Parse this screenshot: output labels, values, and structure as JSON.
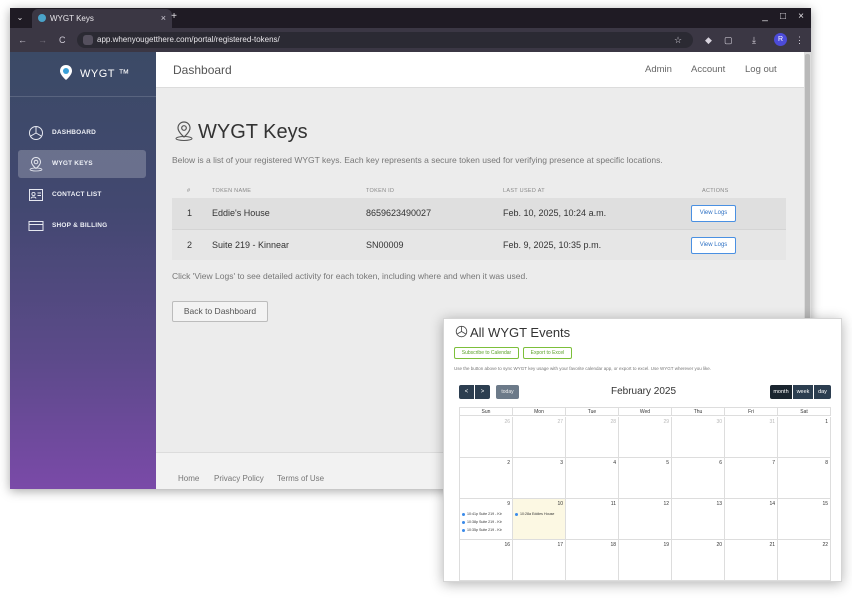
{
  "browser": {
    "tab_title": "WYGT Keys",
    "tab_close": "×",
    "new_tab": "+",
    "url": "app.whenyougetthere.com/portal/registered-tokens/",
    "nav": {
      "back": "←",
      "forward": "→",
      "reload": "C"
    },
    "window_buttons": {
      "minimize": "_",
      "maximize": "□",
      "close": "×"
    },
    "profile_initial": "R"
  },
  "sidebar": {
    "brand": "WYGT ™",
    "items": [
      {
        "label": "DASHBOARD",
        "icon": "pie-chart-icon"
      },
      {
        "label": "WYGT KEYS",
        "icon": "location-pin-icon"
      },
      {
        "label": "CONTACT LIST",
        "icon": "contact-card-icon"
      },
      {
        "label": "SHOP & BILLING",
        "icon": "credit-card-icon"
      }
    ]
  },
  "topnav": {
    "title": "Dashboard",
    "links": [
      "Admin",
      "Account",
      "Log out"
    ]
  },
  "main": {
    "title": "WYGT Keys",
    "description": "Below is a list of your registered WYGT keys. Each key represents a secure token used for verifying presence at specific locations.",
    "table": {
      "headers": [
        "#",
        "TOKEN NAME",
        "TOKEN ID",
        "LAST USED AT",
        "ACTIONS"
      ],
      "rows": [
        {
          "num": "1",
          "name": "Eddie's House",
          "id": "8659623490027",
          "last_used": "Feb. 10, 2025, 10:24 a.m.",
          "action": "View Logs"
        },
        {
          "num": "2",
          "name": "Suite 219 - Kinnear",
          "id": "SN00009",
          "last_used": "Feb. 9, 2025, 10:35 p.m.",
          "action": "View Logs"
        }
      ]
    },
    "hint": "Click 'View Logs' to see detailed activity for each token, including where and when it was used.",
    "back_button": "Back to Dashboard"
  },
  "footer": {
    "links": [
      "Home",
      "Privacy Policy",
      "Terms of Use"
    ]
  },
  "calendar": {
    "title": "All WYGT Events",
    "subscribe_button": "Subscribe to Calendar",
    "export_button": "Export to Excel",
    "description": "Use the button above to sync WYGT key usage with your favorite calendar app, or export to excel. Use WYGT wherever you like.",
    "prev": "<",
    "next": ">",
    "today": "today",
    "month_label": "February 2025",
    "views": [
      "month",
      "week",
      "day"
    ],
    "weekdays": [
      "Sun",
      "Mon",
      "Tue",
      "Wed",
      "Thu",
      "Fri",
      "Sat"
    ],
    "weeks": [
      [
        "26",
        "27",
        "28",
        "29",
        "30",
        "31",
        "1"
      ],
      [
        "2",
        "3",
        "4",
        "5",
        "6",
        "7",
        "8"
      ],
      [
        "9",
        "10",
        "11",
        "12",
        "13",
        "14",
        "15"
      ],
      [
        "16",
        "17",
        "18",
        "19",
        "20",
        "21",
        "22"
      ]
    ],
    "events_sun_9": [
      "10:41p Suite 219 - Kir",
      "10:38p Suite 219 - Kir",
      "10:35p Suite 219 - Kir"
    ],
    "events_mon_10": [
      "10:28a Eddies House"
    ],
    "accent": "#3b8bea",
    "today_bg": "#fcf8e3"
  }
}
